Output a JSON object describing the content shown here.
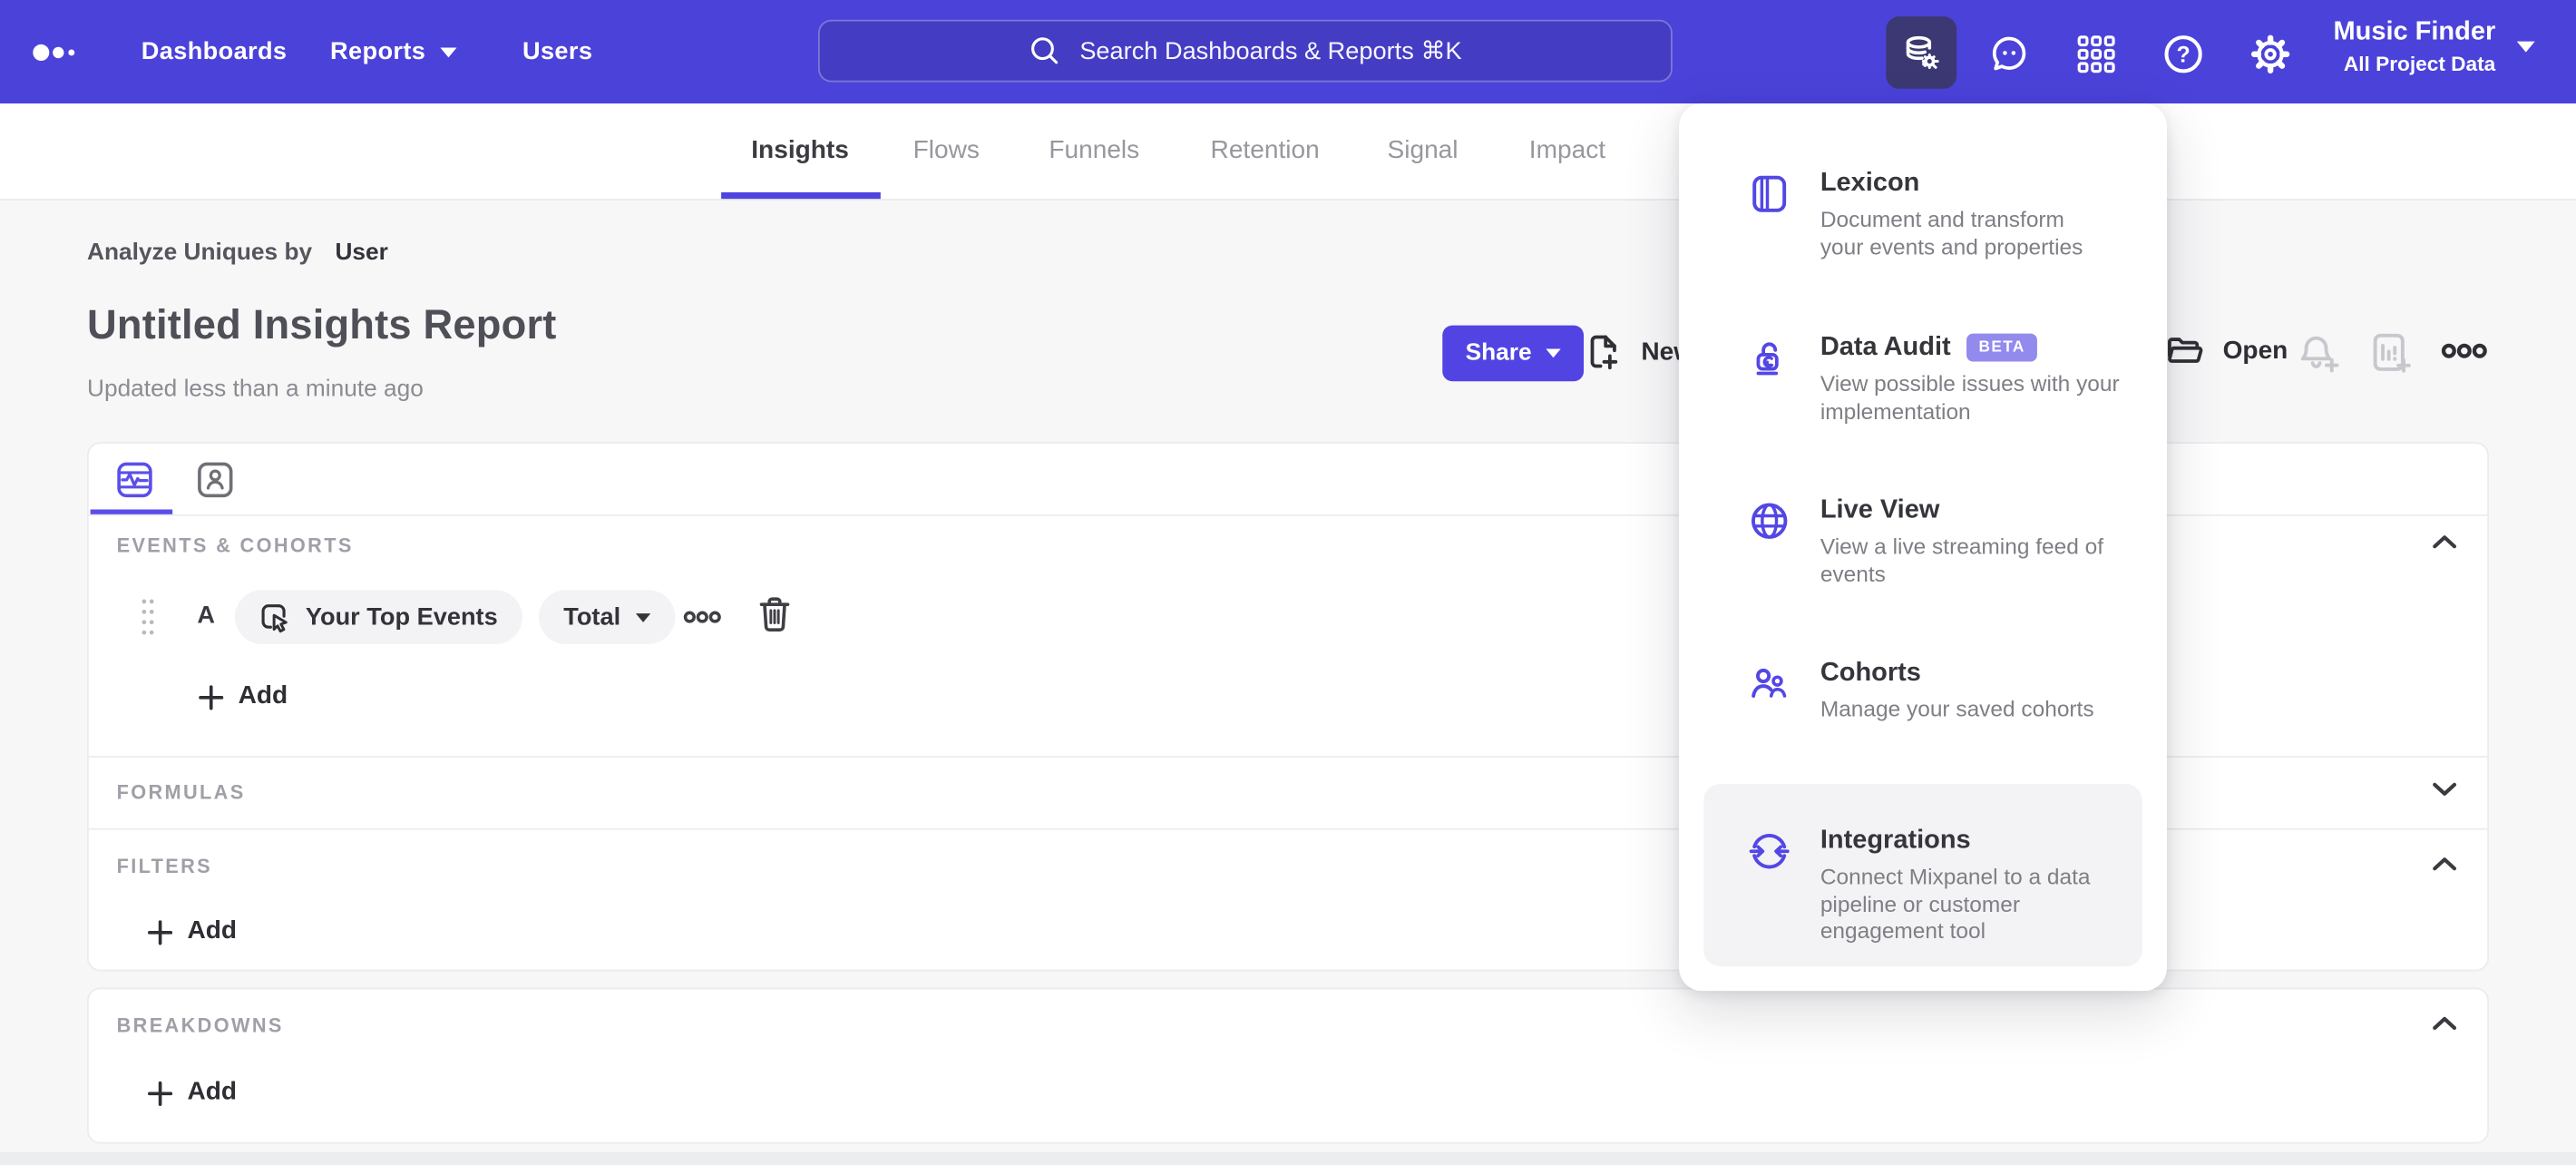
{
  "header": {
    "nav": [
      {
        "label": "Dashboards"
      },
      {
        "label": "Reports"
      },
      {
        "label": "Users"
      }
    ],
    "search_placeholder": "Search Dashboards & Reports ⌘K",
    "project_name": "Music Finder",
    "project_dataset": "All Project Data"
  },
  "report_tabs": [
    {
      "label": "Insights"
    },
    {
      "label": "Flows"
    },
    {
      "label": "Funnels"
    },
    {
      "label": "Retention"
    },
    {
      "label": "Signal"
    },
    {
      "label": "Impact"
    }
  ],
  "report": {
    "analyze_label": "Analyze Uniques by",
    "analyze_value": "User",
    "title": "Untitled Insights Report",
    "updated": "Updated less than a minute ago",
    "share": "Share",
    "new": "New",
    "open": "Open"
  },
  "builder": {
    "events_label": "EVENTS & COHORTS",
    "row": {
      "letter": "A",
      "event": "Your Top Events",
      "metric": "Total"
    },
    "add": "Add",
    "formulas_label": "FORMULAS",
    "filters_label": "FILTERS",
    "breakdowns_label": "BREAKDOWNS"
  },
  "menu": {
    "items": [
      {
        "title": "Lexicon",
        "desc_lines": [
          "Document and transform",
          "your events and properties"
        ]
      },
      {
        "title": "Data Audit",
        "badge": "BETA",
        "desc_lines": [
          "View possible issues with your",
          "implementation"
        ]
      },
      {
        "title": "Live View",
        "desc_lines": [
          "View a live streaming feed of",
          "events"
        ]
      },
      {
        "title": "Cohorts",
        "desc_lines": [
          "Manage your saved cohorts"
        ]
      },
      {
        "title": "Integrations",
        "desc_lines": [
          "Connect Mixpanel to a data",
          "pipeline or customer",
          "engagement tool"
        ]
      }
    ]
  },
  "colors": {
    "header_purple": "#4b42da",
    "accent_purple": "#4f44e0",
    "active_icon_bg": "#3b3873",
    "beta_badge": "#928aec",
    "page_bg": "#f7f7f8"
  }
}
